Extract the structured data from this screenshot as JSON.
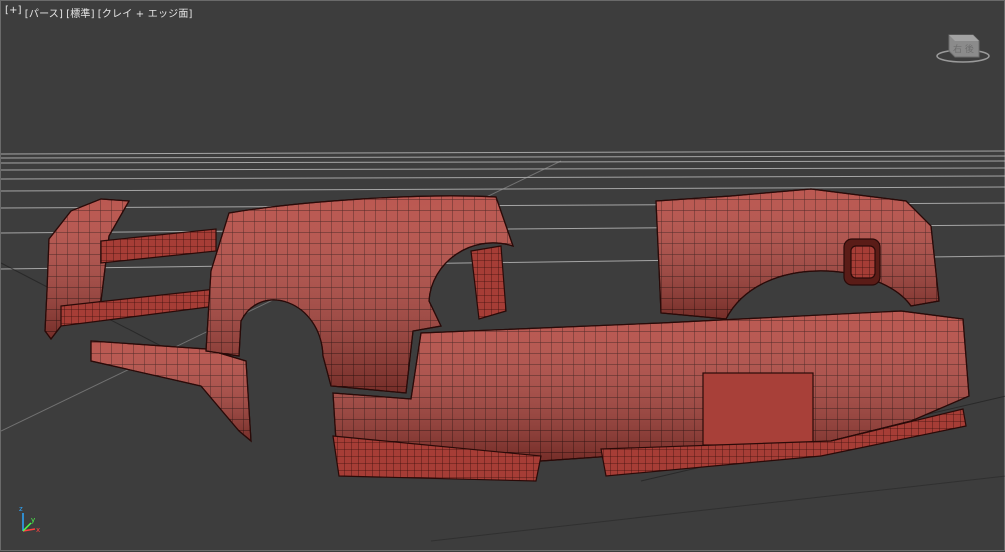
{
  "viewport": {
    "label_menu_plus": "[+]",
    "label_view": "[パース]",
    "label_shading": "[標準]",
    "label_style": "[クレイ + エッジ面]"
  },
  "viewcube": {
    "face_label": "右 後",
    "icon": "viewcube-icon"
  },
  "axis_gizmo": {
    "x_label": "x",
    "y_label": "y",
    "z_label": "z"
  },
  "colors": {
    "background": "#3d3d3d",
    "grid_line": "#bdbdbd",
    "mesh_fill": "#b8473f",
    "mesh_edge": "#3a0f0c"
  }
}
